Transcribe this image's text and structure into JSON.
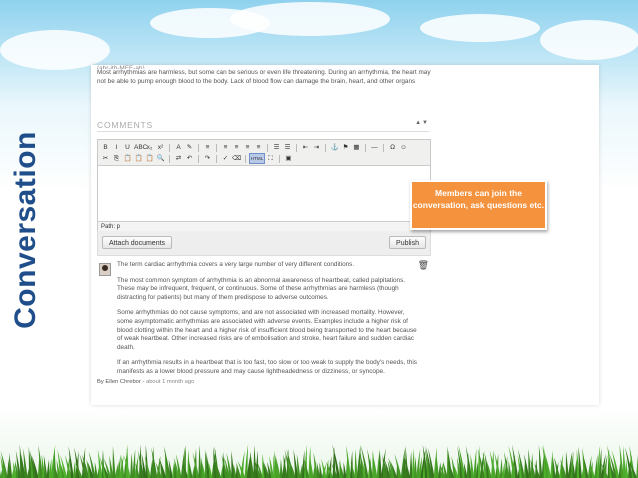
{
  "slide_title": "Conversation",
  "intro": {
    "clipped_line": "(ahr-ith-MEE-ah)",
    "text": "Most arrhythmias are harmless, but some can be serious or even life threatening. During an arrhythmia, the heart may not be able to pump enough blood to the body. Lack of blood flow can damage the brain, heart, and other organs"
  },
  "comments_section": {
    "heading": "COMMENTS",
    "arrows": "▲▼"
  },
  "editor": {
    "toolbar_row1": [
      "B",
      "I",
      "U",
      "ABC",
      "x₂",
      "x²",
      "A",
      "✎",
      "≡",
      "≡",
      "≡",
      "≡",
      "≡",
      "☰",
      "☰",
      "⇤",
      "⇥",
      "⚓",
      "⚑",
      "▦",
      "—",
      "Ω",
      "☺"
    ],
    "toolbar_row2": [
      "✂",
      "⎘",
      "📋",
      "📋",
      "📋",
      "🔍",
      "⇄",
      "↶",
      "↷",
      "✓",
      "⌫",
      "HTML",
      "⛶",
      "▣"
    ],
    "path_label": "Path: p"
  },
  "buttons": {
    "attach": "Attach documents",
    "publish": "Publish"
  },
  "callout": "Members can join the conversation, ask questions etc.",
  "comment": {
    "paragraphs": [
      "The term cardiac arrhythmia covers a very large number of very different conditions.",
      "The most common symptom of arrhythmia is an abnormal awareness of heartbeat, called palpitations. These may be infrequent, frequent, or continuous. Some of these arrhythmias are harmless (though distracting for patients) but many of them predispose to adverse outcomes.",
      "Some arrhythmias do not cause symptoms, and are not associated with increased mortality. However, some asymptomatic arrhythmias are associated with adverse events. Examples include a higher risk of blood clotting within the heart and a higher risk of insufficient blood being transported to the heart because of weak heartbeat. Other increased risks are of embolisation and stroke, heart failure and sudden cardiac death.",
      "If an arrhythmia results in a heartbeat that is too fast, too slow or too weak to supply the body's needs, this manifests as a lower blood pressure and may cause lightheadedness or dizziness, or syncope."
    ],
    "author": "By Ellen Chrebor",
    "date": "about 1 month ago"
  },
  "colors": {
    "title": "#1f4e8a",
    "callout": "#f4923d"
  }
}
